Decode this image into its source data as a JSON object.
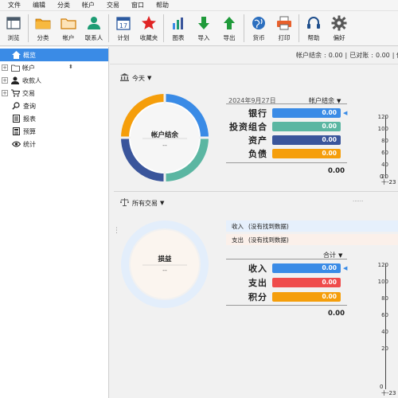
{
  "menu": [
    "文件",
    "编辑",
    "分类",
    "帐户",
    "交易",
    "窗口",
    "帮助"
  ],
  "toolbar": {
    "browse": "浏览",
    "category": "分类",
    "account": "帐户",
    "contact": "联系人",
    "schedule": "计划",
    "favorites": "收藏夹",
    "chart": "图表",
    "import": "导入",
    "export": "导出",
    "currency": "货币",
    "print": "打印",
    "help": "帮助",
    "prefs": "偏好",
    "calendar_day": "17"
  },
  "sidebar": {
    "items": [
      {
        "label": "概览"
      },
      {
        "label": "帐户"
      },
      {
        "label": "收款人"
      },
      {
        "label": "交易"
      },
      {
        "label": "查询"
      },
      {
        "label": "报表"
      },
      {
        "label": "预算"
      },
      {
        "label": "统计"
      }
    ]
  },
  "infobar": {
    "balance_label": "帐户结余",
    "balance_value": "0.00",
    "reconciled_label": "已对账",
    "reconciled_value": "0.00",
    "sep": "|",
    "trailing": "|  传"
  },
  "section1": {
    "title": "今天",
    "date": "2024年9月27日",
    "dropdown": "帐户结余",
    "donut_label": "帐户结余",
    "donut_sub": "--",
    "rows": [
      {
        "name": "银行",
        "value": "0.00",
        "color": "#3a8be6"
      },
      {
        "name": "投资组合",
        "value": "0.00",
        "color": "#5bb6a2"
      },
      {
        "name": "资产",
        "value": "0.00",
        "color": "#3a559b"
      },
      {
        "name": "负债",
        "value": "0.00",
        "color": "#f59e0b"
      }
    ],
    "total": "0.00",
    "yaxis": [
      "120",
      "100",
      "80",
      "60",
      "40",
      "20",
      "0",
      "十-23"
    ]
  },
  "section2": {
    "title": "所有交易",
    "dots": "......",
    "income_label": "收入",
    "income_note": "(没有找到数据)",
    "expense_label": "支出",
    "expense_note": "(没有找到数据)",
    "dropdown": "合计",
    "donut_label": "损益",
    "donut_sub": "--",
    "rows": [
      {
        "name": "收入",
        "value": "0.00",
        "color": "#3a8be6"
      },
      {
        "name": "支出",
        "value": "0.00",
        "color": "#ef4b4b"
      },
      {
        "name": "积分",
        "value": "0.00",
        "color": "#f59e0b"
      }
    ],
    "total": "0.00",
    "yaxis": [
      "120",
      "100",
      "80",
      "60",
      "40",
      "20",
      "0",
      "十-23"
    ]
  }
}
